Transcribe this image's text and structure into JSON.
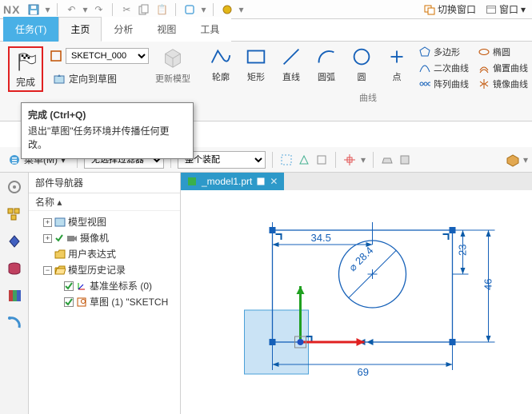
{
  "app_logo": "NX",
  "title_actions": {
    "switch_window": "切换窗口",
    "window_menu": "窗口"
  },
  "tabs": {
    "task": "任务(T)",
    "home": "主页",
    "analyze": "分析",
    "view": "视图",
    "tools": "工具"
  },
  "ribbon": {
    "finish": "完成",
    "sketch_select": "SKETCH_000",
    "orient_to_sketch": "定向到草图",
    "update_model": "更新模型",
    "profile": "轮廓",
    "rectangle": "矩形",
    "line": "直线",
    "arc": "圆弧",
    "circle": "圆",
    "point": "点",
    "polygon": "多边形",
    "ellipse": "椭圆",
    "conic": "二次曲线",
    "offset_curve": "偏置曲线",
    "pattern_curve": "阵列曲线",
    "mirror_curve": "镜像曲线",
    "group_curve": "曲线"
  },
  "tooltip": {
    "title": "完成 (Ctrl+Q)",
    "body": "退出\"草图\"任务环境并传播任何更改。"
  },
  "toolbar2": {
    "menu": "菜单(M)",
    "filter_sel": "无选择过滤器",
    "assembly_sel": "整个装配"
  },
  "nav": {
    "panel_title": "部件导航器",
    "col_name": "名称",
    "nodes": {
      "model_views": "模型视图",
      "cameras": "摄像机",
      "user_expr": "用户表达式",
      "model_history": "模型历史记录",
      "datum_csys": "基准坐标系 (0)",
      "sketch": "草图 (1) \"SKETCH"
    }
  },
  "doc_tab": "_model1.prt",
  "dims": {
    "d1": "34.5",
    "d2": "23",
    "d3": "46",
    "d4": "69",
    "diam": "⌀ 28.4"
  }
}
